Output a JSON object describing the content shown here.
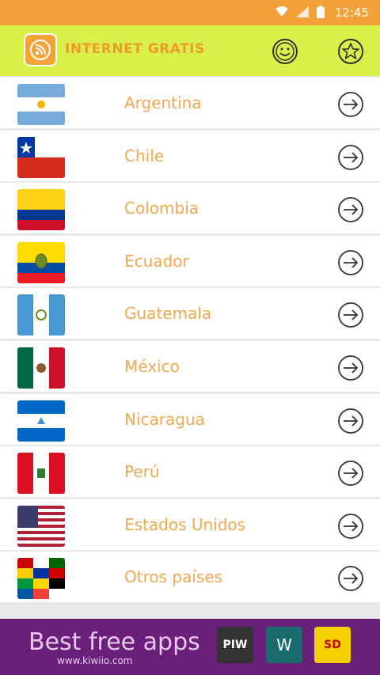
{
  "status": {
    "time": "12:45"
  },
  "app": {
    "title": "INTERNET GRATIS"
  },
  "countries": [
    {
      "label": "Argentina",
      "flag": "argentina"
    },
    {
      "label": "Chile",
      "flag": "chile"
    },
    {
      "label": "Colombia",
      "flag": "colombia"
    },
    {
      "label": "Ecuador",
      "flag": "ecuador"
    },
    {
      "label": "Guatemala",
      "flag": "guatemala"
    },
    {
      "label": "México",
      "flag": "mexico"
    },
    {
      "label": "Nicaragua",
      "flag": "nicaragua"
    },
    {
      "label": "Perú",
      "flag": "peru"
    },
    {
      "label": "Estados Unidos",
      "flag": "usa"
    },
    {
      "label": "Otros países",
      "flag": "world-flags"
    }
  ],
  "ad": {
    "title": "Best free apps",
    "url": "www.kiwiio.com",
    "apps": [
      "PIW",
      "W",
      "SD"
    ]
  },
  "colors": {
    "status_bar": "#f5a13a",
    "app_bar": "#d9f04a",
    "label_text": "#f0a84e",
    "ad_background": "#6a1f78"
  }
}
